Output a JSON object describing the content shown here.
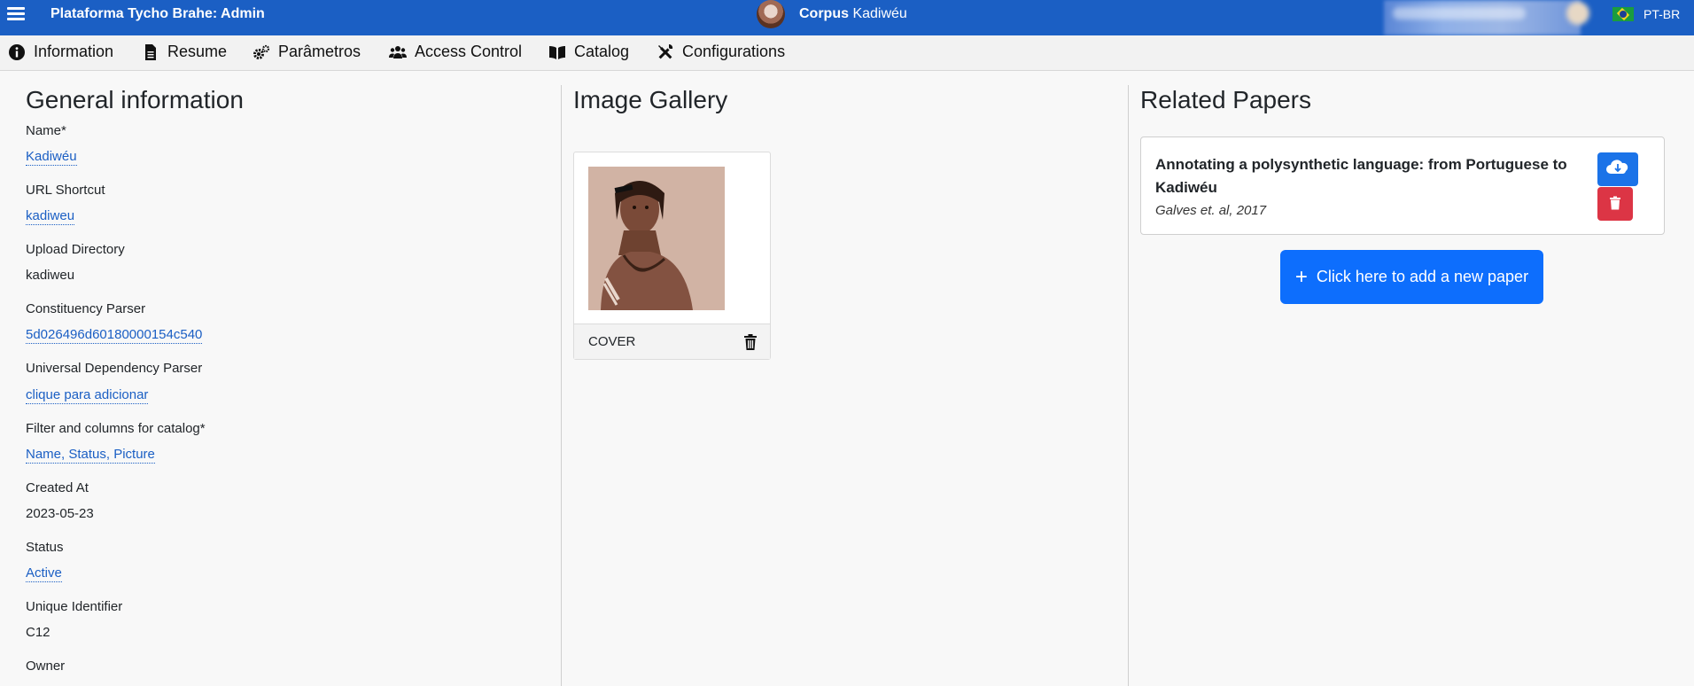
{
  "topbar": {
    "app_title": "Plataforma Tycho Brahe: Admin",
    "corpus_prefix": "Corpus",
    "corpus_name": "Kadiwéu",
    "language": "PT-BR",
    "colors": {
      "bar": "#1b5fc4"
    }
  },
  "nav": {
    "items": [
      {
        "label": "Information",
        "icon": "info-circle-icon"
      },
      {
        "label": "Resume",
        "icon": "file-icon"
      },
      {
        "label": "Parâmetros",
        "icon": "cogs-icon"
      },
      {
        "label": "Access Control",
        "icon": "users-icon"
      },
      {
        "label": "Catalog",
        "icon": "book-open-icon"
      },
      {
        "label": "Configurations",
        "icon": "tools-icon"
      }
    ]
  },
  "general": {
    "title": "General information",
    "fields": [
      {
        "label": "Name*",
        "value": "Kadiwéu"
      },
      {
        "label": "URL Shortcut",
        "value": "kadiweu"
      },
      {
        "label": "Upload Directory",
        "value": "kadiweu"
      },
      {
        "label": "Constituency Parser",
        "value": "5d026496d60180000154c540"
      },
      {
        "label": "Universal Dependency Parser",
        "value": "clique para adicionar"
      },
      {
        "label": "Filter and columns for catalog*",
        "value": "Name, Status, Picture"
      },
      {
        "label": "Created At",
        "value": "2023-05-23"
      },
      {
        "label": "Status",
        "value": "Active"
      },
      {
        "label": "Unique Identifier",
        "value": "C12"
      },
      {
        "label": "Owner",
        "value": ""
      }
    ]
  },
  "gallery": {
    "title": "Image Gallery",
    "images": [
      {
        "caption": "COVER"
      }
    ]
  },
  "papers": {
    "title": "Related Papers",
    "items": [
      {
        "title": "Annotating a polysynthetic language: from Portuguese to Kadiwéu",
        "citation": "Galves et. al, 2017"
      }
    ],
    "add_label": "Click here to add a new paper"
  }
}
